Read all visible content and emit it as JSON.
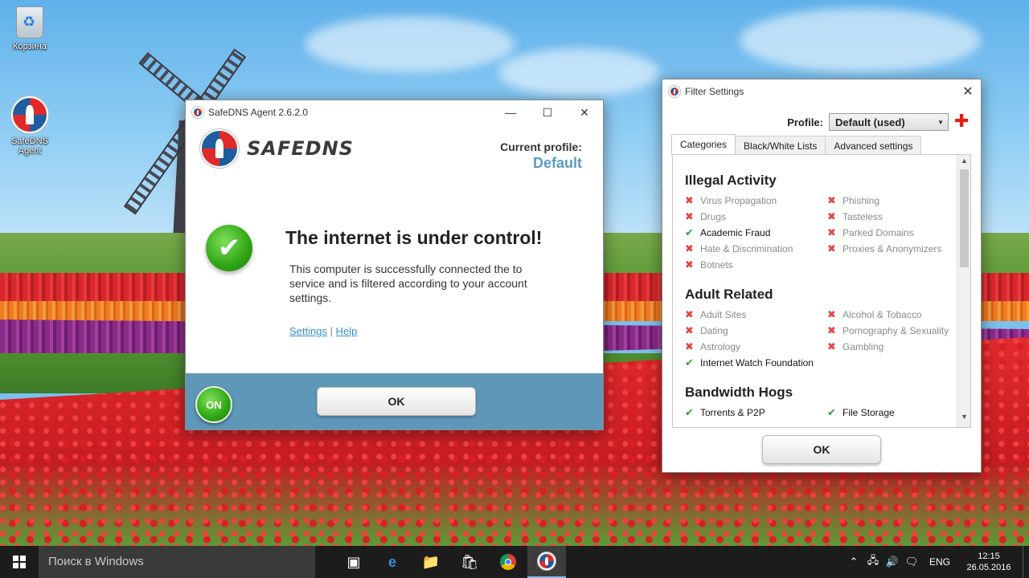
{
  "desktop": {
    "icons": [
      {
        "label": "Корзина",
        "icon": "recycle-bin-icon"
      },
      {
        "label": "SafeDNS\nAgent",
        "label_line1": "SafeDNS",
        "label_line2": "Agent",
        "icon": "safedns-logo-icon"
      }
    ]
  },
  "agent_window": {
    "title": "SafeDNS Agent 2.6.2.0",
    "brand": "SAFEDNS",
    "current_profile_label": "Current profile:",
    "current_profile_value": "Default",
    "headline": "The internet is under control!",
    "description": "This computer is successfully connected the to service and is filtered according to your account settings.",
    "links": {
      "settings": "Settings",
      "separator": "|",
      "help": "Help"
    },
    "toggle_label": "ON",
    "ok_label": "OK"
  },
  "filter_window": {
    "title": "Filter Settings",
    "profile_label": "Profile:",
    "profile_selected": "Default (used)",
    "tabs": [
      {
        "label": "Categories",
        "active": true
      },
      {
        "label": "Black/White Lists",
        "active": false
      },
      {
        "label": "Advanced settings",
        "active": false
      }
    ],
    "groups": [
      {
        "title": "Illegal Activity",
        "items": [
          {
            "label": "Virus Propagation",
            "status": "blocked"
          },
          {
            "label": "Phishing",
            "status": "blocked"
          },
          {
            "label": "Drugs",
            "status": "blocked"
          },
          {
            "label": "Tasteless",
            "status": "blocked"
          },
          {
            "label": "Academic Fraud",
            "status": "allowed"
          },
          {
            "label": "Parked Domains",
            "status": "blocked"
          },
          {
            "label": "Hate & Discrimination",
            "status": "blocked"
          },
          {
            "label": "Proxies & Anonymizers",
            "status": "blocked"
          },
          {
            "label": "Botnets",
            "status": "blocked"
          }
        ]
      },
      {
        "title": "Adult Related",
        "items": [
          {
            "label": "Adult Sites",
            "status": "blocked"
          },
          {
            "label": "Alcohol & Tobacco",
            "status": "blocked"
          },
          {
            "label": "Dating",
            "status": "blocked"
          },
          {
            "label": "Pornography & Sexuality",
            "status": "blocked"
          },
          {
            "label": "Astrology",
            "status": "blocked"
          },
          {
            "label": "Gambling",
            "status": "blocked"
          },
          {
            "label": "Internet Watch Foundation",
            "status": "allowed"
          }
        ]
      },
      {
        "title": "Bandwidth Hogs",
        "items": [
          {
            "label": "Torrents & P2P",
            "status": "allowed"
          },
          {
            "label": "File Storage",
            "status": "allowed"
          }
        ]
      }
    ],
    "ok_label": "OK"
  },
  "taskbar": {
    "search_placeholder": "Поиск в Windows",
    "language": "ENG",
    "time": "12:15",
    "date": "26.05.2016"
  },
  "colors": {
    "accent_blue": "#5a9bc9",
    "footer_blue": "#5f97b9",
    "blocked_red": "#e04545",
    "allowed_green": "#2ea52e"
  }
}
